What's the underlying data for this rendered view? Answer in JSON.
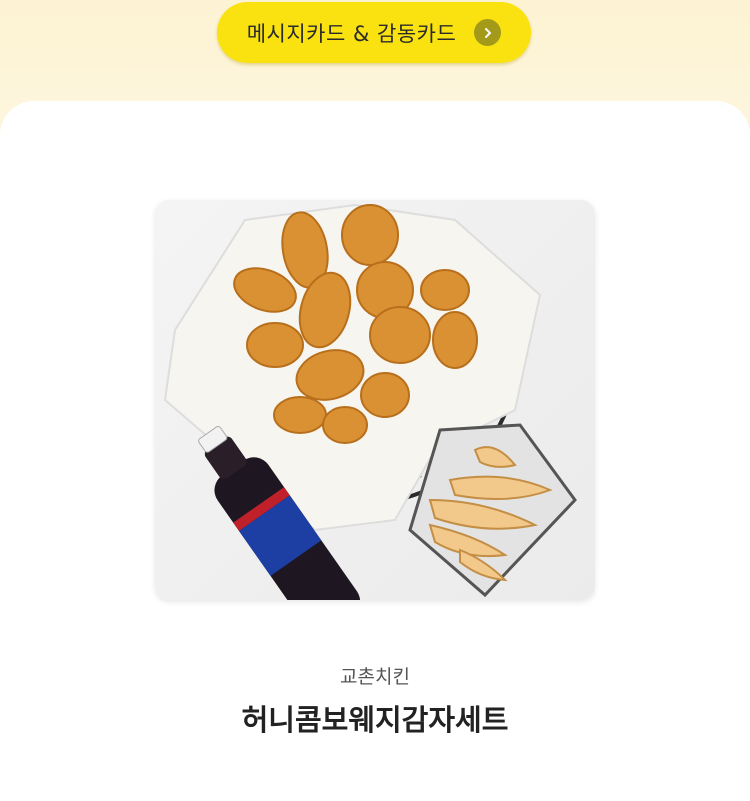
{
  "banner": {
    "button_label": "메시지카드 & 감동카드",
    "arrow_icon": "chevron-right-icon",
    "colors": {
      "pill": "#f9e20f",
      "arrow_bg": "#a49a1a",
      "page_bg": "#fdf6dc"
    }
  },
  "product": {
    "brand": "교촌치킨",
    "name": "허니콤보웨지감자세트",
    "image_icon": "fried-chicken-set-photo"
  }
}
